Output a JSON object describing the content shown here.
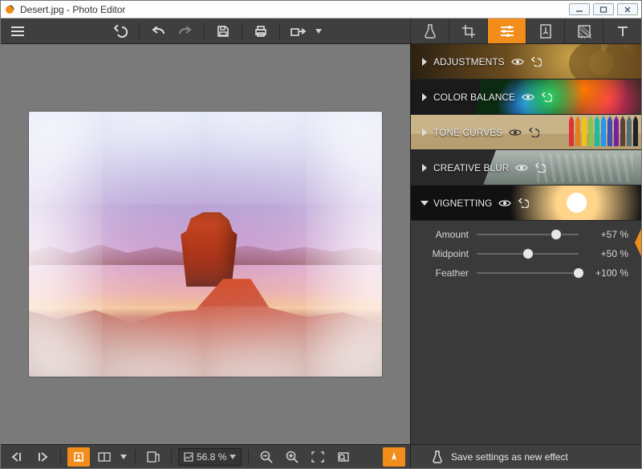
{
  "window": {
    "title": "Desert.jpg - Photo Editor"
  },
  "tool_tabs": [
    {
      "name": "effects-tab",
      "icon": "flask-icon"
    },
    {
      "name": "crop-tab",
      "icon": "crop-icon"
    },
    {
      "name": "adjust-tab",
      "icon": "sliders-icon",
      "active": true
    },
    {
      "name": "frames-tab",
      "icon": "frame-icon"
    },
    {
      "name": "textures-tab",
      "icon": "texture-icon"
    },
    {
      "name": "text-tab",
      "icon": "text-icon"
    }
  ],
  "categories": {
    "adjustments": {
      "label": "ADJUSTMENTS",
      "expanded": false
    },
    "color_balance": {
      "label": "COLOR BALANCE",
      "expanded": false
    },
    "tone_curves": {
      "label": "TONE CURVES",
      "expanded": false
    },
    "creative_blur": {
      "label": "CREATIVE BLUR",
      "expanded": false
    },
    "vignetting": {
      "label": "VIGNETTING",
      "expanded": true
    }
  },
  "vignetting": {
    "amount": {
      "label": "Amount",
      "value": 57,
      "display": "+57 %",
      "pos_pct": 78
    },
    "midpoint": {
      "label": "Midpoint",
      "value": 50,
      "display": "+50 %",
      "pos_pct": 50
    },
    "feather": {
      "label": "Feather",
      "value": 100,
      "display": "+100 %",
      "pos_pct": 100
    }
  },
  "zoom": {
    "display": "56.8 %"
  },
  "footer": {
    "save_effect_label": "Save settings as new effect"
  }
}
